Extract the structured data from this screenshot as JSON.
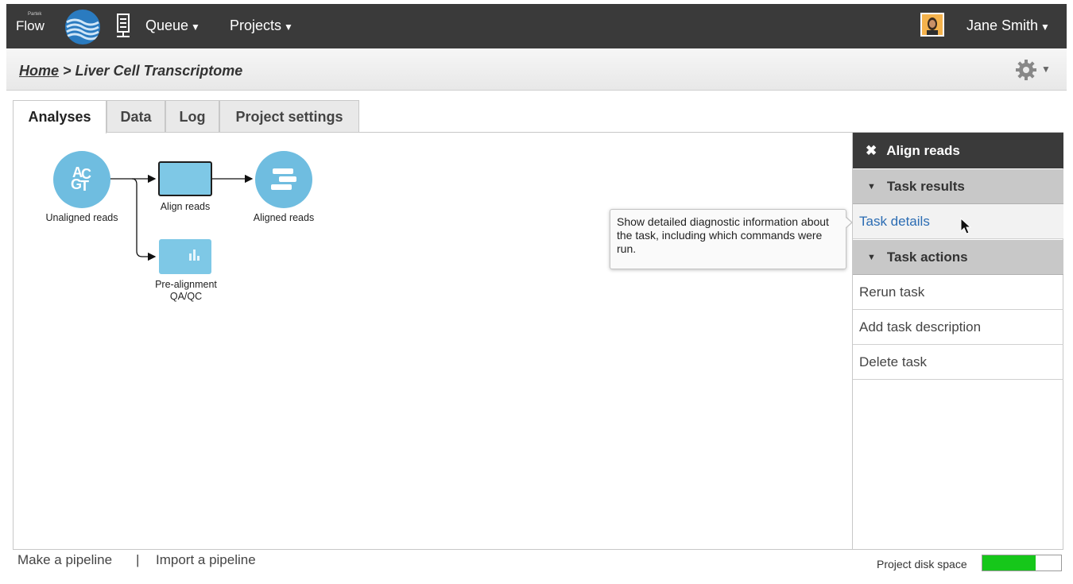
{
  "app": {
    "logo_text": "Flow",
    "logo_small_text": "Partek"
  },
  "nav": {
    "queue_label": "Queue",
    "projects_label": "Projects",
    "chevron": "⌄",
    "user_name": "Jane Smith"
  },
  "breadcrumb": {
    "home": "Home",
    "separator": " > ",
    "current": "Liver Cell Transcriptome"
  },
  "tabs": [
    {
      "label": "Analyses",
      "active": true
    },
    {
      "label": "Data",
      "active": false
    },
    {
      "label": "Log",
      "active": false
    },
    {
      "label": "Project settings",
      "active": false
    }
  ],
  "pipeline": {
    "nodes": {
      "unaligned": "Unaligned reads",
      "align_task": "Align reads",
      "aligned": "Aligned reads",
      "qc_task_line1": "Pre-alignment",
      "qc_task_line2": "QA/QC"
    }
  },
  "tooltip": {
    "text": "Show detailed diagnostic information about the task, including which commands were run."
  },
  "side_panel": {
    "title": "Align reads",
    "close_glyph": "✖",
    "task_results_label": "Task results",
    "task_details_label": "Task details",
    "task_actions_label": "Task actions",
    "actions": [
      "Rerun task",
      "Add task description",
      "Delete task"
    ],
    "triangle": "▼"
  },
  "footer": {
    "make_pipeline": "Make a pipeline",
    "separator": "|",
    "import_pipeline": "Import a pipeline",
    "disk_label": "Project disk space",
    "disk_usage_fraction": 0.68,
    "disk_color": "#16c71a"
  },
  "colors": {
    "topbar": "#3a3a3a",
    "node_blue": "#6fbde0",
    "link_blue": "#2b6cb3"
  }
}
